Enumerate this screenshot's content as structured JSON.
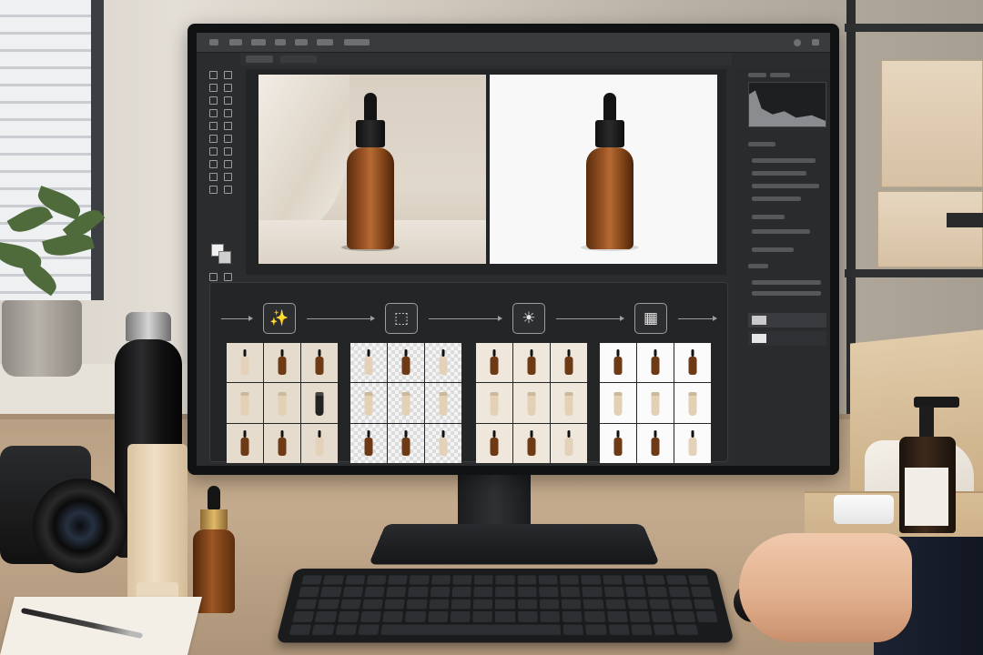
{
  "scene": {
    "description_colors": {
      "monitor_frame": "#111214",
      "editor_bg": "#2b2c2e",
      "bottle_amber": "#9a5424",
      "desk": "#c4ab8e"
    }
  },
  "editor": {
    "workflow_steps": [
      {
        "icon": "magic-wand-icon",
        "glyph": "✨"
      },
      {
        "icon": "selection-cursor-icon",
        "glyph": "⬚"
      },
      {
        "icon": "brightness-icon",
        "glyph": "☀"
      },
      {
        "icon": "grid-layout-icon",
        "glyph": "▦"
      }
    ],
    "grids": [
      {
        "name": "original-set",
        "style": "beige"
      },
      {
        "name": "background-removed-set",
        "style": "transparent"
      },
      {
        "name": "color-corrected-set",
        "style": "warm"
      },
      {
        "name": "final-white-set",
        "style": "white"
      }
    ]
  }
}
